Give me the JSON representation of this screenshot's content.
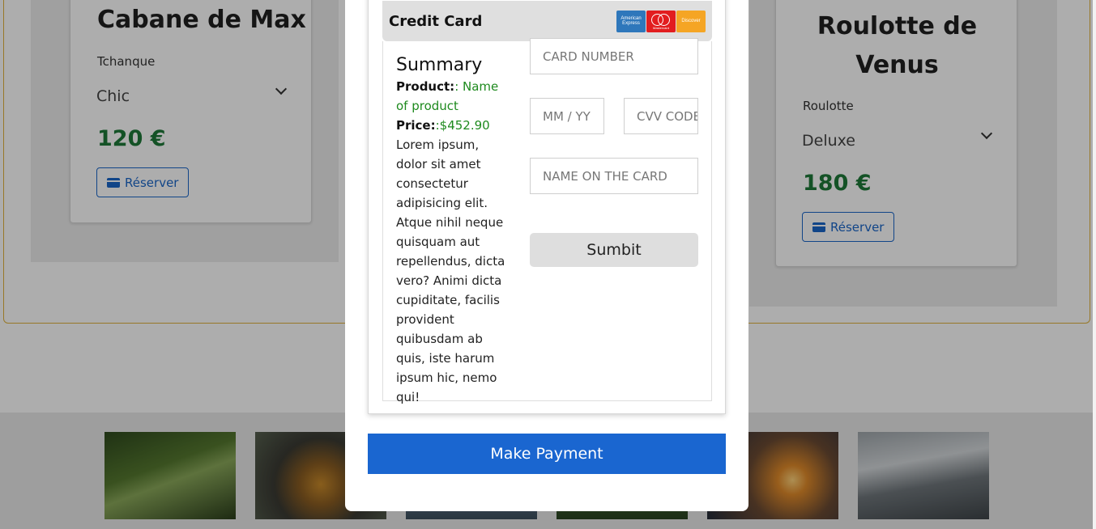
{
  "listings": [
    {
      "title": "Cabane de Max",
      "type": "Tchanque",
      "category": "Chic",
      "price": "120 €",
      "reserve_label": "Réserver"
    },
    {
      "title": "Roulotte de Venus",
      "type": "Roulotte",
      "category": "Deluxe",
      "price": "180 €",
      "reserve_label": "Réserver"
    }
  ],
  "gallery": {
    "images": [
      "forest-waterfall",
      "hiker-backpack",
      "mountain-landscape",
      "green-landscape",
      "cabin-sunset",
      "river-rapids"
    ]
  },
  "payment": {
    "header_title": "Credit Card",
    "card_logos": [
      "American Express",
      "Mastercard",
      "Discover"
    ],
    "summary": {
      "title": "Summary",
      "product_label": "Product:",
      "product_value": ": Name of product",
      "price_label": "Price:",
      "price_value": ":$452.90",
      "description": "Lorem ipsum, dolor sit amet consectetur adipisicing elit. Atque nihil neque quisquam aut repellendus, dicta vero? Animi dicta cupiditate, facilis provident quibusdam ab quis, iste harum ipsum hic, nemo qui!"
    },
    "fields": {
      "card_number": "CARD NUMBER",
      "expiry": "MM / YY",
      "cvv": "CVV CODE",
      "name_on_card": "NAME ON THE CARD"
    },
    "submit_label": "Sumbit",
    "make_payment_label": "Make Payment"
  },
  "colors": {
    "accent_blue": "#1a66d0",
    "price_green": "#1e7a38",
    "border_gold": "#e0b23a"
  }
}
